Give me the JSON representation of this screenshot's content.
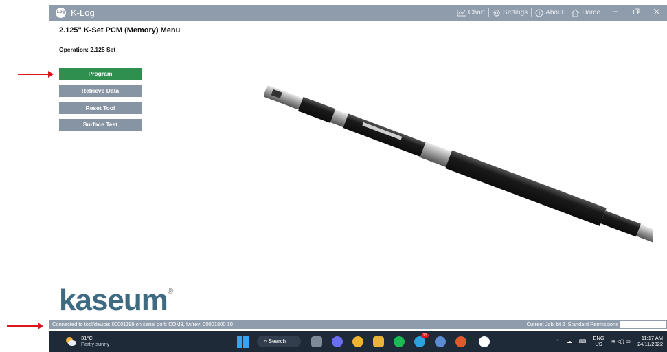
{
  "window": {
    "title": "K-Log",
    "logo_text": "Log",
    "toolbar": [
      {
        "label": "Chart",
        "icon": "chart-icon"
      },
      {
        "label": "Settings",
        "icon": "gear-icon"
      },
      {
        "label": "About",
        "icon": "info-icon"
      },
      {
        "label": "Home",
        "icon": "home-icon"
      }
    ]
  },
  "main": {
    "menu_title": "2.125\" K-Set PCM (Memory) Menu",
    "operation_label": "Operation: 2.125 Set",
    "buttons": [
      "Program",
      "Retrieve Data",
      "Reset Tool",
      "Surface Test"
    ],
    "brand": "kaseum",
    "brand_mark": "®"
  },
  "status": {
    "connection": "Connected to tool/device: 00001199 on serial port: COM3, fw/rev: 00001800 10",
    "job": "Current Job: bt 2",
    "permissions": "Standard Permissions"
  },
  "taskbar": {
    "weather_temp": "31°C",
    "weather_desc": "Partly sunny",
    "search_label": "Search",
    "lang_top": "ENG",
    "lang_bottom": "US",
    "time": "11:17 AM",
    "date": "24/11/2022",
    "telegram_badge": "13"
  },
  "colors": {
    "titlebar": "#8f9cab",
    "primary_button": "#2f8f4e",
    "secondary_button": "#8694a3",
    "annotation_arrow": "#e0151b",
    "brand": "#3f6b82"
  }
}
